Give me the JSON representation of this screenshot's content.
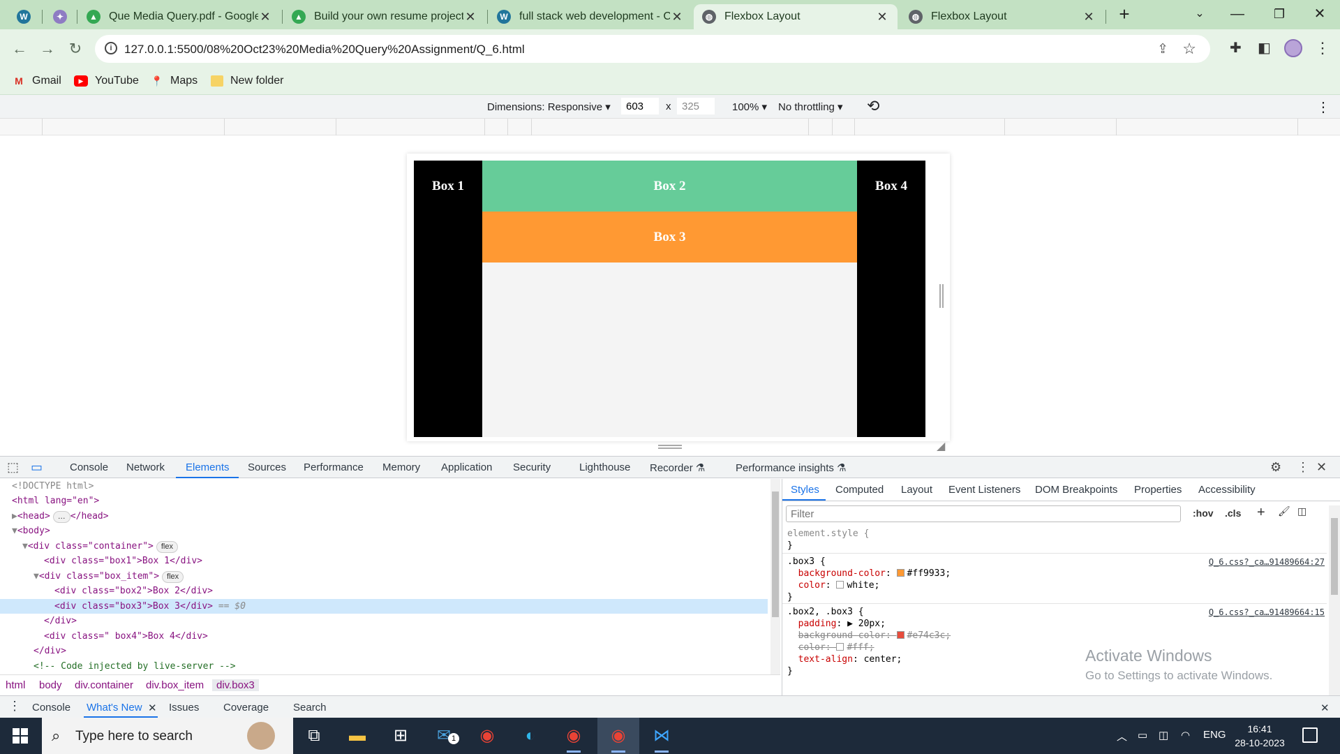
{
  "browser": {
    "tabs": [
      {
        "title": "",
        "icon": "wordpress-icon",
        "color": "#21759b"
      },
      {
        "title": "",
        "icon": "ai-sparkle-icon",
        "color": "#8e7cc3"
      },
      {
        "title": "Que Media Query.pdf - Google",
        "icon": "google-drive-icon",
        "color": "#34a853"
      },
      {
        "title": "Build your own resume project.",
        "icon": "google-drive-icon",
        "color": "#34a853"
      },
      {
        "title": "full stack web development - Co",
        "icon": "wordpress-icon",
        "color": "#21759b"
      },
      {
        "title": "Flexbox Layout",
        "icon": "globe-icon",
        "color": "#5f6368",
        "active": true
      },
      {
        "title": "Flexbox Layout",
        "icon": "globe-icon",
        "color": "#5f6368"
      }
    ],
    "url": "127.0.0.1:5500/08%20Oct23%20Media%20Query%20Assignment/Q_6.html",
    "bookmarks": [
      {
        "label": "Gmail",
        "icon": "gmail-icon"
      },
      {
        "label": "YouTube",
        "icon": "youtube-icon"
      },
      {
        "label": "Maps",
        "icon": "maps-icon"
      },
      {
        "label": "New folder",
        "icon": "folder-icon"
      }
    ]
  },
  "device_toolbar": {
    "dimensions_label": "Dimensions: Responsive",
    "width": "603",
    "height": "325",
    "times": "x",
    "zoom": "100%",
    "throttling": "No throttling"
  },
  "page": {
    "box1": "Box 1",
    "box2": "Box 2",
    "box3": "Box 3",
    "box4": "Box 4",
    "colors": {
      "box2": "#66cc99",
      "box3": "#ff9933",
      "side": "#000000"
    }
  },
  "devtools": {
    "tabs": [
      "Console",
      "Network",
      "Elements",
      "Sources",
      "Performance",
      "Memory",
      "Application",
      "Security",
      "Lighthouse",
      "Recorder",
      "Performance insights"
    ],
    "active_tab": "Elements",
    "dom": {
      "doctype": "<!DOCTYPE html>",
      "html_open": "<html lang=\"en\">",
      "head": "<head>",
      "head_close": "</head>",
      "body_open": "<body>",
      "container_open": "<div class=\"container\">",
      "box1_line": "<div class=\"box1\">Box 1</div>",
      "box_item_open": "<div class=\"box_item\">",
      "box2_line": "<div class=\"box2\">Box 2</div>",
      "box3_line": "<div class=\"box3\">Box 3</div>",
      "selected_marker": "== $0",
      "div_close": "</div>",
      "box4_line": "<div class=\" box4\">Box 4</div>",
      "container_close": "</div>",
      "comment": "<!-- Code injected by live-server -->",
      "flex_badge": "flex",
      "ellipsis": "…"
    },
    "breadcrumbs": [
      "html",
      "body",
      "div.container",
      "div.box_item",
      "div.box3"
    ],
    "styles_tabs": [
      "Styles",
      "Computed",
      "Layout",
      "Event Listeners",
      "DOM Breakpoints",
      "Properties",
      "Accessibility"
    ],
    "filter_placeholder": "Filter",
    "hov": ":hov",
    "cls": ".cls",
    "rules": {
      "element_style": "element.style {",
      "close_brace": "}",
      "box3_selector": ".box3 {",
      "box3_source": "Q_6.css?_ca…91489664:27",
      "box3_bg_prop": "background-color",
      "box3_bg_val": "#ff9933;",
      "box3_color_prop": "color",
      "box3_color_val": "white;",
      "shared_selector": ".box2, .box3 {",
      "shared_source": "Q_6.css?_ca…91489664:15",
      "padding_prop": "padding",
      "padding_val": "20px;",
      "shared_bg_prop": "background-color",
      "shared_bg_val": "#e74c3c;",
      "shared_color_prop": "color",
      "shared_color_val": "#fff;",
      "align_prop": "text-align",
      "align_val": "center;"
    },
    "watermark_title": "Activate Windows",
    "watermark_sub": "Go to Settings to activate Windows.",
    "drawer_tabs": [
      "Console",
      "What's New",
      "Issues",
      "Coverage",
      "Search"
    ],
    "drawer_active": "What's New"
  },
  "taskbar": {
    "search_placeholder": "Type here to search",
    "language": "ENG",
    "time": "16:41",
    "date": "28-10-2023",
    "mail_badge": "1"
  }
}
